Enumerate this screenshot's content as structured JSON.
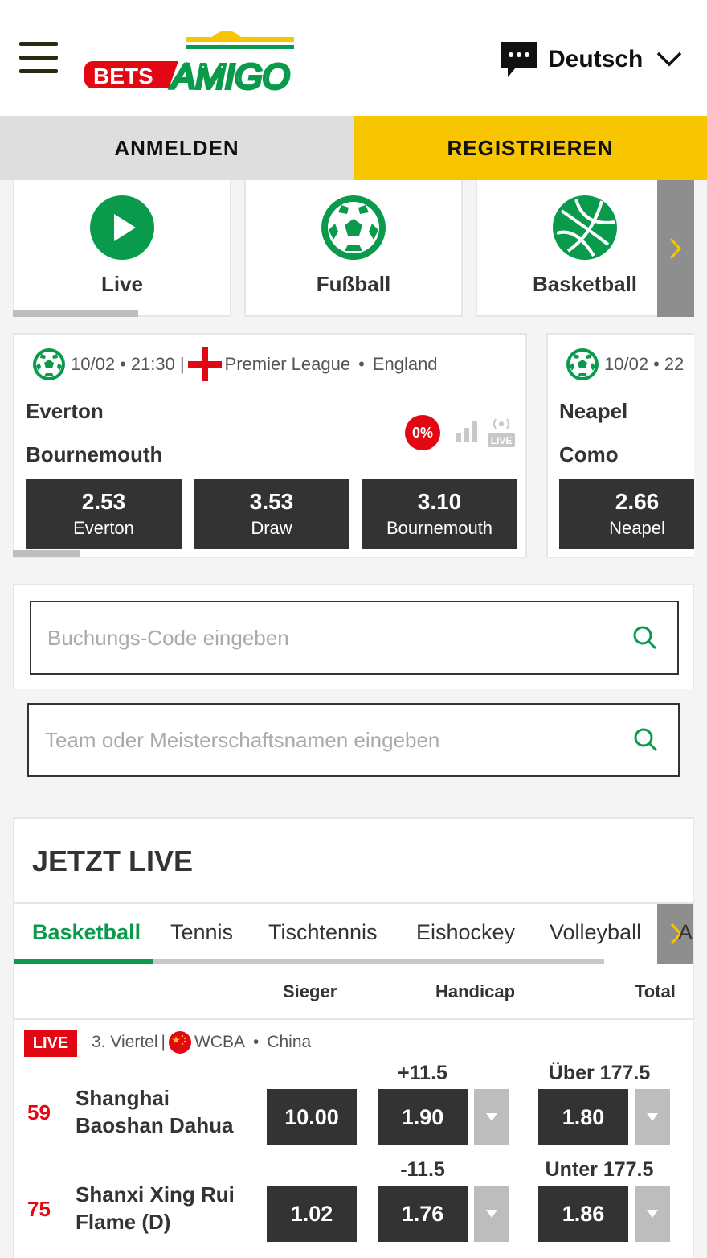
{
  "header": {
    "logo_text_left": "BETS",
    "logo_text_right": "AMIGO",
    "language": "Deutsch"
  },
  "auth": {
    "login": "ANMELDEN",
    "register": "REGISTRIEREN"
  },
  "sports": [
    {
      "label": "Live",
      "icon": "play-icon"
    },
    {
      "label": "Fußball",
      "icon": "soccer-ball-icon"
    },
    {
      "label": "Basketball",
      "icon": "basketball-icon"
    }
  ],
  "featured_matches": [
    {
      "date": "10/02",
      "time": "21:30",
      "league": "Premier League",
      "country": "England",
      "home": "Everton",
      "away": "Bournemouth",
      "margin": "0%",
      "odds": [
        {
          "value": "2.53",
          "label": "Everton"
        },
        {
          "value": "3.53",
          "label": "Draw"
        },
        {
          "value": "3.10",
          "label": "Bournemouth"
        }
      ]
    },
    {
      "date": "10/02",
      "time_partial": "22",
      "home": "Neapel",
      "away": "Como",
      "odds": [
        {
          "value": "2.66",
          "label": "Neapel"
        }
      ]
    }
  ],
  "search": {
    "booking_placeholder": "Buchungs-Code eingeben",
    "team_placeholder": "Team oder Meisterschaftsnamen eingeben"
  },
  "live": {
    "title": "JETZT LIVE",
    "tabs": [
      "Basketball",
      "Tennis",
      "Tischtennis",
      "Eishockey",
      "Volleyball"
    ],
    "tab_overflow": "A",
    "columns": {
      "winner": "Sieger",
      "handicap": "Handicap",
      "total": "Total"
    },
    "event": {
      "badge": "LIVE",
      "period": "3. Viertel",
      "league": "WCBA",
      "country": "China",
      "teams": [
        {
          "score": "59",
          "name_line1": "Shanghai",
          "name_line2": "Baoshan Dahua",
          "winner": "10.00",
          "hcp_line": "+11.5",
          "hcp_odd": "1.90",
          "total_line": "Über 177.5",
          "total_odd": "1.80"
        },
        {
          "score": "75",
          "name_line1": "Shanxi Xing Rui",
          "name_line2": "Flame (D)",
          "winner": "1.02",
          "hcp_line": "-11.5",
          "hcp_odd": "1.76",
          "total_line": "Unter 177.5",
          "total_odd": "1.86"
        }
      ]
    }
  },
  "colors": {
    "brand_green": "#0a9a4c",
    "brand_yellow": "#f8c600",
    "live_red": "#e30613",
    "dark": "#333333"
  }
}
